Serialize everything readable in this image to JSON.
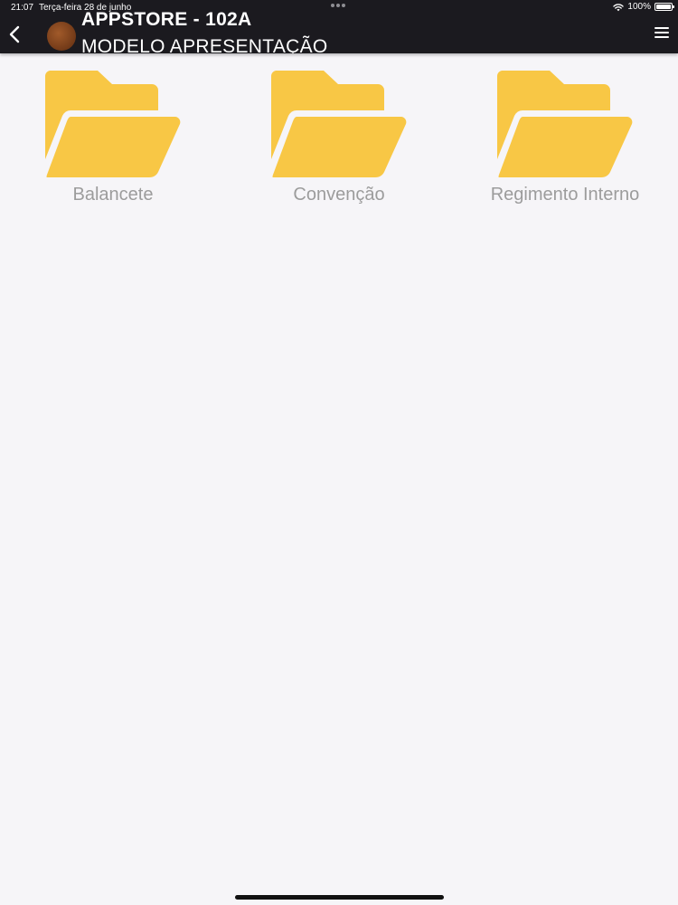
{
  "status_bar": {
    "time": "21:07",
    "date": "Terça-feira 28 de junho",
    "battery": "100%",
    "battery_level": 1.0
  },
  "header": {
    "title": "APPSTORE - 102A",
    "subtitle": "MODELO APRESENTAÇÃO",
    "back_icon": "chevron-left-icon",
    "menu_icon": "hamburger-menu-icon"
  },
  "folders": [
    {
      "label": "Balancete",
      "icon": "folder-open-icon"
    },
    {
      "label": "Convenção",
      "icon": "folder-open-icon"
    },
    {
      "label": "Regimento Interno",
      "icon": "folder-open-icon"
    }
  ],
  "colors": {
    "header_background": "#1b1a1f",
    "page_background": "#f6f5f8",
    "folder_yellow": "#f8c745",
    "label_gray": "#9c9c9c"
  }
}
